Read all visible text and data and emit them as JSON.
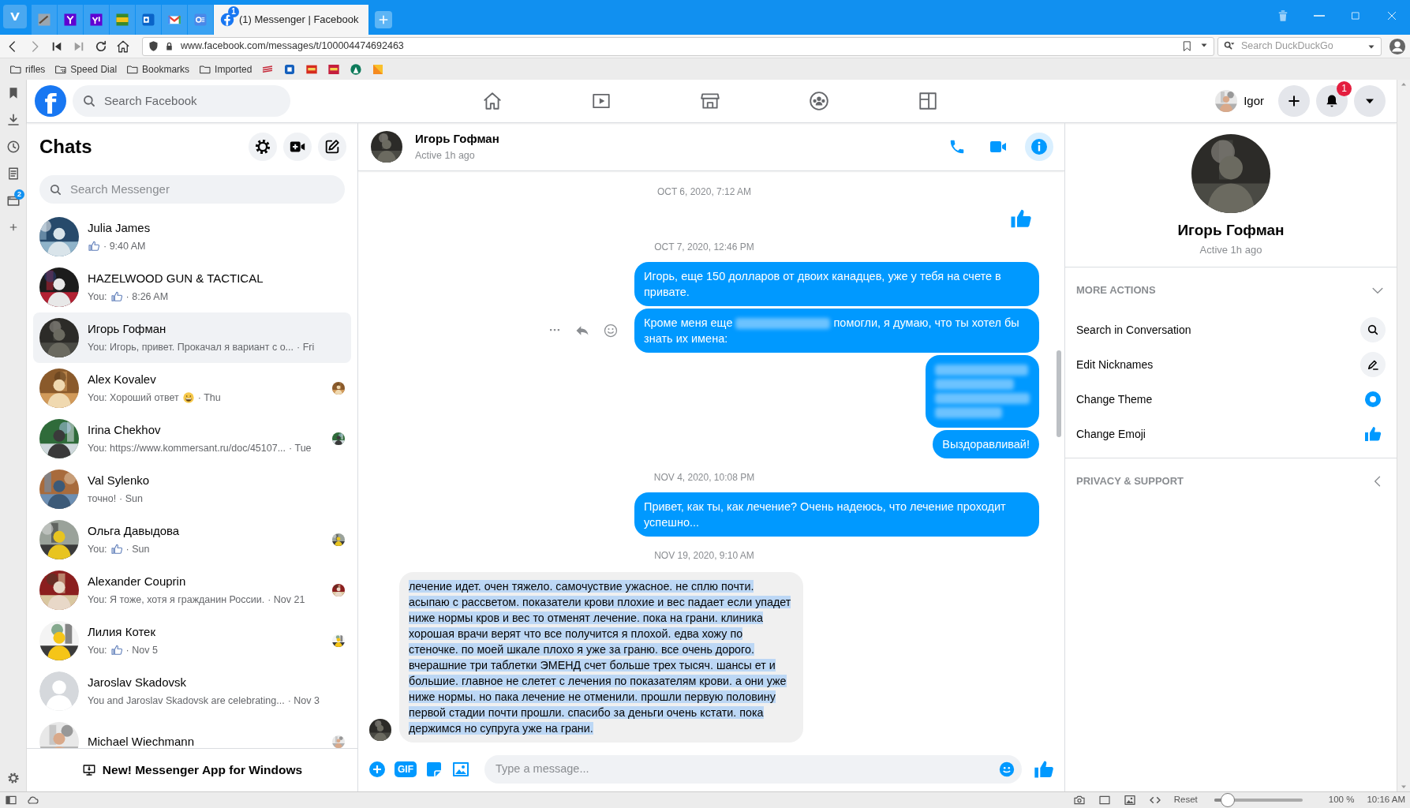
{
  "browser": {
    "tabs": [
      {
        "selected": false
      },
      {
        "selected": false
      },
      {
        "selected": false
      },
      {
        "selected": false
      },
      {
        "selected": false
      },
      {
        "selected": false
      },
      {
        "selected": false
      },
      {
        "title": "(1) Messenger | Facebook",
        "badge": "1",
        "selected": true
      }
    ],
    "address": "www.facebook.com/messages/t/100004474692463",
    "search_placeholder": "Search DuckDuckGo",
    "bookmarks": [
      {
        "label": "rifles",
        "kind": "folder"
      },
      {
        "label": "Speed Dial",
        "kind": "speed_dial"
      },
      {
        "label": "Bookmarks",
        "kind": "folder"
      },
      {
        "label": "Imported",
        "kind": "folder"
      }
    ],
    "panel_badge": "2"
  },
  "facebook": {
    "logo": "f",
    "search_placeholder": "Search Facebook",
    "user": "Igor",
    "notifications": "1"
  },
  "chats": {
    "title": "Chats",
    "search_placeholder": "Search Messenger",
    "items": [
      {
        "name": "Julia James",
        "preview_like": true,
        "time": "· 9:40 AM",
        "has_photo": true,
        "selected": false,
        "seen": false
      },
      {
        "name": "HAZELWOOD GUN & TACTICAL",
        "preview": "You:",
        "preview_like": true,
        "time": "· 8:26 AM",
        "has_photo": true,
        "selected": false,
        "seen": false
      },
      {
        "name": "Игорь Гофман",
        "preview": "You: Игорь, привет. Прокачал я вариант с о...",
        "time": "· Fri",
        "has_photo": true,
        "selected": true,
        "seen": false
      },
      {
        "name": "Alex Kovalev",
        "preview": "You: Хороший ответ",
        "preview_emoji": true,
        "time": "· Thu",
        "has_photo": true,
        "selected": false,
        "seen": true
      },
      {
        "name": "Irina Chekhov",
        "preview": "You: https://www.kommersant.ru/doc/45107...",
        "time": "· Tue",
        "has_photo": true,
        "selected": false,
        "seen": true
      },
      {
        "name": "Val Sylenko",
        "preview": "точно!",
        "time": "· Sun",
        "has_photo": true,
        "selected": false,
        "seen": false
      },
      {
        "name": "Ольга Давыдова",
        "preview": "You:",
        "preview_like": true,
        "time": "· Sun",
        "has_photo": true,
        "selected": false,
        "seen": true
      },
      {
        "name": "Alexander Couprin",
        "preview": "You: Я тоже, хотя я гражданин России.",
        "time": "· Nov 21",
        "has_photo": true,
        "selected": false,
        "seen": true
      },
      {
        "name": "Лилия Котек",
        "preview": "You:",
        "preview_like": true,
        "time": "· Nov 5",
        "has_photo": true,
        "selected": false,
        "seen": true
      },
      {
        "name": "Jaroslav Skadovsk",
        "preview": "You and Jaroslav Skadovsk are celebrating...",
        "time": "· Nov 3",
        "has_photo": false,
        "selected": false,
        "seen": false
      },
      {
        "name": "Michael Wiechmann",
        "has_photo": true,
        "selected": false,
        "seen": true
      }
    ],
    "footer": "New! Messenger App for Windows"
  },
  "conversation": {
    "name": "Игорь Гофман",
    "status": "Active 1h ago",
    "info_selected": true,
    "timeline": [
      {
        "kind": "timestamp",
        "text": "OCT 6, 2020, 7:12 AM"
      },
      {
        "kind": "like"
      },
      {
        "kind": "timestamp",
        "text": "OCT 7, 2020, 12:46 PM"
      },
      {
        "kind": "outgoing",
        "hover": false,
        "parts": [
          {
            "kind": "text",
            "text": "Игорь, еще 150 долларов от двоих канадцев, уже у тебя на счете в привате."
          }
        ]
      },
      {
        "kind": "outgoing",
        "hover": true,
        "parts": [
          {
            "kind": "text",
            "text": "Кроме меня еще "
          },
          {
            "kind": "redacted"
          },
          {
            "kind": "text",
            "text": " помогли, я думаю, что ты хотел бы знать их имена:"
          }
        ]
      },
      {
        "kind": "outgoing",
        "hover": false,
        "parts": [
          {
            "kind": "redacted"
          },
          {
            "kind": "redacted"
          },
          {
            "kind": "redacted"
          },
          {
            "kind": "redacted"
          }
        ]
      },
      {
        "kind": "outgoing",
        "hover": false,
        "parts": [
          {
            "kind": "text",
            "text": "Выздоравливай!"
          }
        ]
      },
      {
        "kind": "timestamp",
        "text": "NOV 4, 2020, 10:08 PM"
      },
      {
        "kind": "outgoing",
        "hover": false,
        "parts": [
          {
            "kind": "text",
            "text": "Привет, как ты, как лечение? Очень надеюсь, что лечение проходит успешно..."
          }
        ]
      },
      {
        "kind": "timestamp",
        "text": "NOV 19, 2020, 9:10 AM"
      },
      {
        "kind": "incoming",
        "text_selected": true,
        "parts": [
          {
            "kind": "text",
            "text": "лечение идет. очен тяжело. самочуствие ужасное. не сплю почти. асыпаю с рассветом. показатели крови плохие и вес падает если упадет ниже нормы кров и вес то отменят лечение. пока на грани. клиника хорошая врачи верят что все получится я плохой. едва хожу по стеночке. по моей шкале плохо я уже за граню. все очень дорого. вчерашние три таблетки ЭМЕНД счет больше трех тысяч. шансы ет и большие. главное не слетет с лечения по показателям крови. а они уже ниже нормы. но пака лечение не отменили. прошли первую половину первой стадии почти прошли. спасибо за деньги очень кстати. пока держимся но супруга уже на грани."
          }
        ]
      }
    ],
    "gif_label": "GIF",
    "composer_placeholder": "Type a message..."
  },
  "details": {
    "name": "Игорь Гофман",
    "status": "Active 1h ago",
    "sections": [
      {
        "title": "MORE ACTIONS",
        "expanded": true,
        "actions": [
          {
            "label": "Search in Conversation",
            "kind": "search"
          },
          {
            "label": "Edit Nicknames",
            "kind": "nickname"
          },
          {
            "label": "Change Theme",
            "kind": "theme"
          },
          {
            "label": "Change Emoji",
            "kind": "emoji"
          }
        ]
      },
      {
        "title": "PRIVACY & SUPPORT",
        "expanded": false
      }
    ]
  },
  "status_bar": {
    "reset": "Reset",
    "level": 0.15,
    "zoom": "100 %",
    "time": "10:16 AM"
  }
}
